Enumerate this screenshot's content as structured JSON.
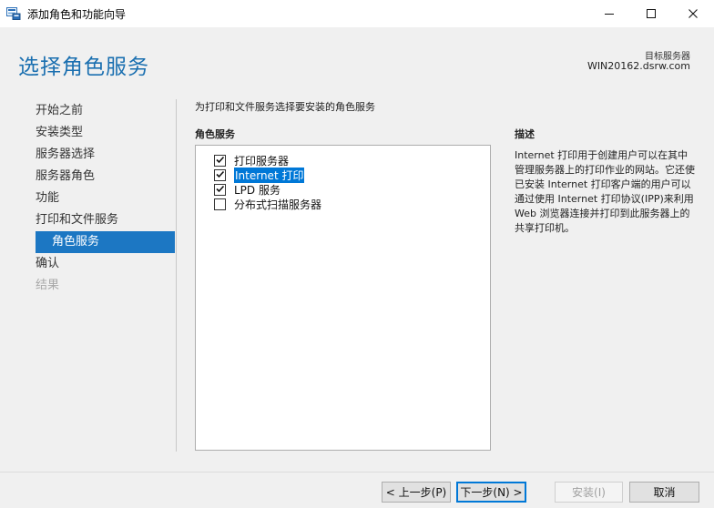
{
  "window": {
    "title": "添加角色和功能向导",
    "controls": {
      "minimize": "minimize-icon",
      "maximize": "maximize-icon",
      "close": "close-icon"
    }
  },
  "header": {
    "page_title": "选择角色服务",
    "destination_label": "目标服务器",
    "destination_server": "WIN20162.dsrw.com"
  },
  "nav": {
    "items": [
      {
        "label": "开始之前",
        "state": "normal"
      },
      {
        "label": "安装类型",
        "state": "normal"
      },
      {
        "label": "服务器选择",
        "state": "normal"
      },
      {
        "label": "服务器角色",
        "state": "normal"
      },
      {
        "label": "功能",
        "state": "normal"
      },
      {
        "label": "打印和文件服务",
        "state": "normal"
      },
      {
        "label": "角色服务",
        "state": "active"
      },
      {
        "label": "确认",
        "state": "normal"
      },
      {
        "label": "结果",
        "state": "disabled"
      }
    ]
  },
  "main": {
    "instruction": "为打印和文件服务选择要安装的角色服务",
    "roles_heading": "角色服务",
    "roles": [
      {
        "label": "打印服务器",
        "checked": true,
        "selected": false
      },
      {
        "label": "Internet 打印",
        "checked": true,
        "selected": true
      },
      {
        "label": "LPD 服务",
        "checked": true,
        "selected": false
      },
      {
        "label": "分布式扫描服务器",
        "checked": false,
        "selected": false
      }
    ],
    "description_heading": "描述",
    "description": "Internet 打印用于创建用户可以在其中管理服务器上的打印作业的网站。它还使已安装 Internet 打印客户端的用户可以通过使用 Internet 打印协议(IPP)来利用 Web 浏览器连接并打印到此服务器上的共享打印机。"
  },
  "footer": {
    "prev_label": "< 上一步(P)",
    "next_label": "下一步(N) >",
    "install_label": "安装(I)",
    "cancel_label": "取消"
  },
  "colors": {
    "accent": "#1c77c3",
    "title_blue": "#1a6fb0",
    "selection": "#0078d7",
    "panel_bg": "#f0f0f0"
  }
}
